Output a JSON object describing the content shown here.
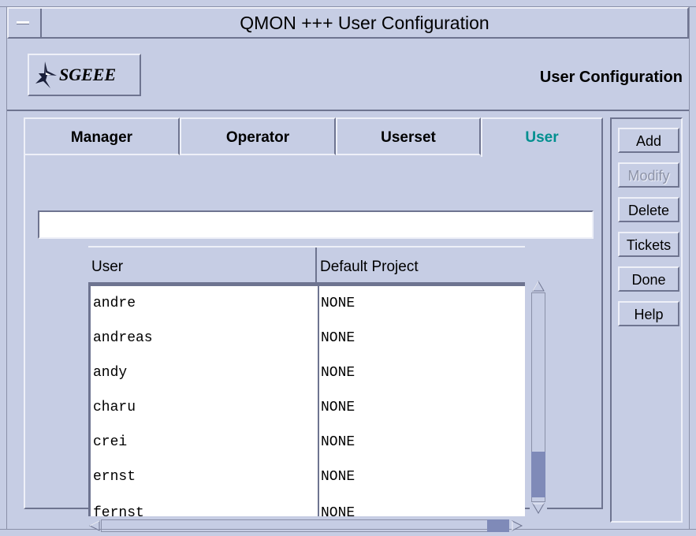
{
  "window": {
    "title": "QMON +++ User Configuration"
  },
  "header": {
    "logo_text": "SGEEE",
    "title": "User Configuration"
  },
  "tabs": [
    {
      "label": "Manager",
      "active": false
    },
    {
      "label": "Operator",
      "active": false
    },
    {
      "label": "Userset",
      "active": false
    },
    {
      "label": "User",
      "active": true
    }
  ],
  "filter": {
    "value": ""
  },
  "table": {
    "columns": [
      "User",
      "Default Project"
    ],
    "rows": [
      {
        "user": "andre",
        "project": "NONE"
      },
      {
        "user": "andreas",
        "project": "NONE"
      },
      {
        "user": "andy",
        "project": "NONE"
      },
      {
        "user": "charu",
        "project": "NONE"
      },
      {
        "user": "crei",
        "project": "NONE"
      },
      {
        "user": "ernst",
        "project": "NONE"
      },
      {
        "user": "fernst",
        "project": "NONE"
      }
    ]
  },
  "buttons": {
    "add": "Add",
    "modify": "Modify",
    "delete": "Delete",
    "tickets": "Tickets",
    "done": "Done",
    "help": "Help"
  },
  "colors": {
    "background": "#c6cde4",
    "active_tab": "#008f8f",
    "scroll_thumb": "#7f8ab8"
  }
}
